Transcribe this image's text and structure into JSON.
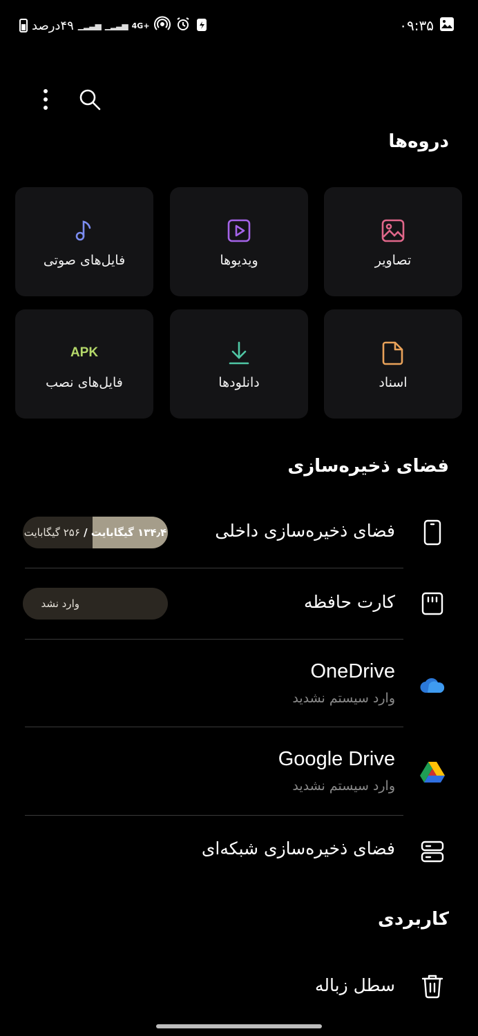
{
  "status_bar": {
    "battery_text": "۴۹درصد",
    "network": "4G+",
    "time": "۰۹:۳۵"
  },
  "toolbar": {
    "more_icon": "more-vert-icon",
    "search_icon": "search-icon"
  },
  "categories": {
    "title": "دروه‌ها",
    "items": [
      {
        "label": "تصاویر",
        "icon": "image-icon",
        "color": "#e0678a"
      },
      {
        "label": "ویدیوها",
        "icon": "video-icon",
        "color": "#a463e8"
      },
      {
        "label": "فایل‌های صوتی",
        "icon": "music-note-icon",
        "color": "#7b8cf0"
      },
      {
        "label": "اسناد",
        "icon": "document-icon",
        "color": "#e9a25a"
      },
      {
        "label": "دانلودها",
        "icon": "download-icon",
        "color": "#4fc7a5"
      },
      {
        "label": "فایل‌های نصب",
        "icon": "apk-icon",
        "icon_text": "APK",
        "color": "#b5d96a"
      }
    ]
  },
  "storage": {
    "title": "فضای ذخیره‌سازی",
    "internal": {
      "label": "فضای ذخیره‌سازی داخلی",
      "used": "۱۳۴٫۴ گیگابایت",
      "total": "۲۵۶ گیگابایت",
      "separator": " / ",
      "used_fraction": 0.52
    },
    "sd_card": {
      "label": "کارت حافظه",
      "status": "وارد نشد"
    },
    "onedrive": {
      "label": "OneDrive",
      "status": "وارد سیستم نشدید",
      "color": "#2b78d8"
    },
    "google_drive": {
      "label": "Google Drive",
      "status": "وارد سیستم نشدید"
    },
    "network": {
      "label": "فضای ذخیره‌سازی شبکه‌ای"
    }
  },
  "utilities": {
    "title": "کاربردی",
    "trash": {
      "label": "سطل زباله"
    }
  }
}
